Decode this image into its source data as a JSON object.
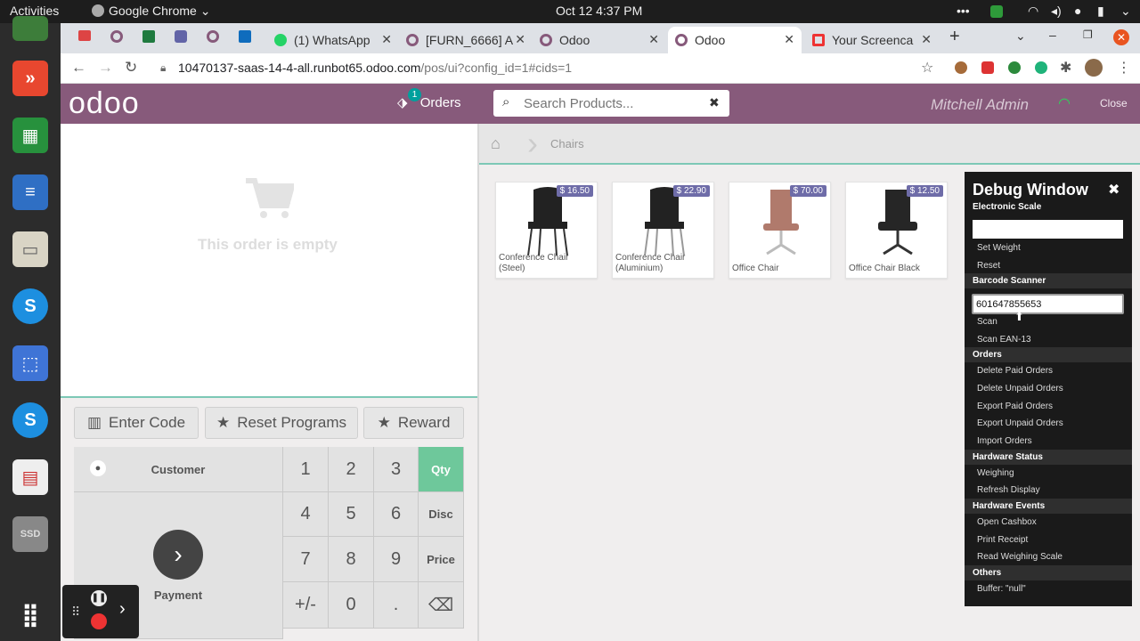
{
  "os": {
    "activities": "Activities",
    "app": "Google Chrome",
    "datetime": "Oct 12  4:37 PM"
  },
  "tabs": [
    {
      "label": "(1) WhatsApp"
    },
    {
      "label": "[FURN_6666] A"
    },
    {
      "label": "Odoo"
    },
    {
      "label": "Odoo"
    },
    {
      "label": "Your Screenca"
    }
  ],
  "address": {
    "host": "10470137-saas-14-4-all.runbot65.odoo.com",
    "path": "/pos/ui?config_id=1#cids=1"
  },
  "header": {
    "logo": "odoo",
    "orders_label": "Orders",
    "orders_badge": "1",
    "search_placeholder": "Search Products...",
    "user": "Mitchell Admin",
    "close": "Close"
  },
  "breadcrumb": {
    "category": "Chairs"
  },
  "order": {
    "empty_text": "This order is empty"
  },
  "controls": {
    "enter_code": "Enter Code",
    "reset_programs": "Reset Programs",
    "reward": "Reward"
  },
  "pad": {
    "customer": "Customer",
    "payment": "Payment",
    "keys": [
      "1",
      "2",
      "3",
      "Qty",
      "4",
      "5",
      "6",
      "Disc",
      "7",
      "8",
      "9",
      "Price",
      "+/-",
      "0",
      ".",
      "⌫"
    ]
  },
  "products": [
    {
      "price": "$ 16.50",
      "name": "Conference Chair (Steel)",
      "color": "#222"
    },
    {
      "price": "$ 22.90",
      "name": "Conference Chair (Aluminium)",
      "color": "#222"
    },
    {
      "price": "$ 70.00",
      "name": "Office Chair",
      "color": "#b07a6c"
    },
    {
      "price": "$ 12.50",
      "name": "Office Chair Black",
      "color": "#262626"
    }
  ],
  "debug": {
    "title": "Debug Window",
    "scale_label": "Electronic Scale",
    "set_weight": "Set Weight",
    "reset": "Reset",
    "barcode_label": "Barcode Scanner",
    "barcode_value": "601647855653",
    "scan": "Scan",
    "scan_ean": "Scan EAN-13",
    "orders_label": "Orders",
    "delete_paid": "Delete Paid Orders",
    "delete_unpaid": "Delete Unpaid Orders",
    "export_paid": "Export Paid Orders",
    "export_unpaid": "Export Unpaid Orders",
    "import": "Import Orders",
    "hw_status": "Hardware Status",
    "weighing": "Weighing",
    "refresh": "Refresh Display",
    "hw_events": "Hardware Events",
    "cashbox": "Open Cashbox",
    "receipt": "Print Receipt",
    "read_scale": "Read Weighing Scale",
    "others": "Others",
    "buffer": "Buffer: \"null\""
  }
}
